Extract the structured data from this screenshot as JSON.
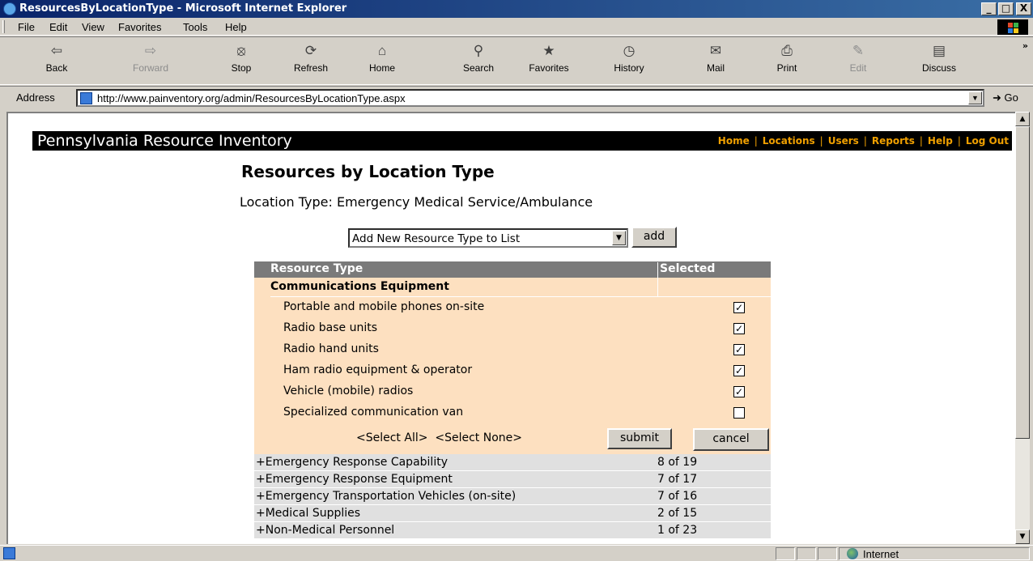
{
  "window": {
    "title": "ResourcesByLocationType - Microsoft Internet Explorer",
    "buttons": [
      "_",
      "·",
      "X"
    ]
  },
  "menu": [
    "File",
    "Edit",
    "View",
    "Favorites",
    "Tools",
    "Help"
  ],
  "toolbar": [
    {
      "label": "Back",
      "icon": "arrow-left-icon"
    },
    {
      "label": "Forward",
      "icon": "arrow-right-icon"
    },
    {
      "label": "Stop",
      "icon": "stop-icon"
    },
    {
      "label": "Refresh",
      "icon": "refresh-icon"
    },
    {
      "label": "Home",
      "icon": "home-icon"
    },
    {
      "label": "Search",
      "icon": "search-icon"
    },
    {
      "label": "Favorites",
      "icon": "favorites-icon"
    },
    {
      "label": "History",
      "icon": "history-icon"
    },
    {
      "label": "Mail",
      "icon": "mail-icon"
    },
    {
      "label": "Print",
      "icon": "print-icon"
    },
    {
      "label": "Edit",
      "icon": "edit-icon"
    },
    {
      "label": "Discuss",
      "icon": "discuss-icon"
    }
  ],
  "address": {
    "label": "Address",
    "url": "http://www.painventory.org/admin/ResourcesByLocationType.aspx",
    "go": "Go"
  },
  "site": {
    "title": "Pennsylvania Resource Inventory",
    "nav": [
      "Home",
      "Locations",
      "Users",
      "Reports",
      "Help",
      "Log Out"
    ],
    "nav_color": "#f0a000"
  },
  "page": {
    "heading": "Resources by Location Type",
    "location_type": "Location Type: Emergency Medical Service/Ambulance",
    "add_select": "Add New Resource Type to List",
    "add_button": "add"
  },
  "grid": {
    "col_resource": "Resource Type",
    "col_selected": "Selected",
    "expanded_category": "Communications Equipment",
    "items": [
      {
        "label": "Portable and mobile phones on-site",
        "checked": true
      },
      {
        "label": "Radio base units",
        "checked": true
      },
      {
        "label": "Radio hand units",
        "checked": true
      },
      {
        "label": "Ham radio equipment & operator",
        "checked": true
      },
      {
        "label": "Vehicle (mobile) radios",
        "checked": true
      },
      {
        "label": "Specialized communication van",
        "checked": false
      }
    ],
    "select_all": "<Select All>",
    "select_none": "<Select None>",
    "submit": "submit",
    "cancel": "cancel",
    "collapsed": [
      {
        "label": "+Emergency Response Capability",
        "count": "8 of 19"
      },
      {
        "label": "+Emergency Response Equipment",
        "count": "7 of 17"
      },
      {
        "label": "+Emergency Transportation Vehicles (on-site)",
        "count": "7 of 16"
      },
      {
        "label": "+Medical Supplies",
        "count": "2 of 15"
      },
      {
        "label": "+Non-Medical Personnel",
        "count": "1 of 23"
      }
    ]
  },
  "status": {
    "zone": "Internet"
  }
}
